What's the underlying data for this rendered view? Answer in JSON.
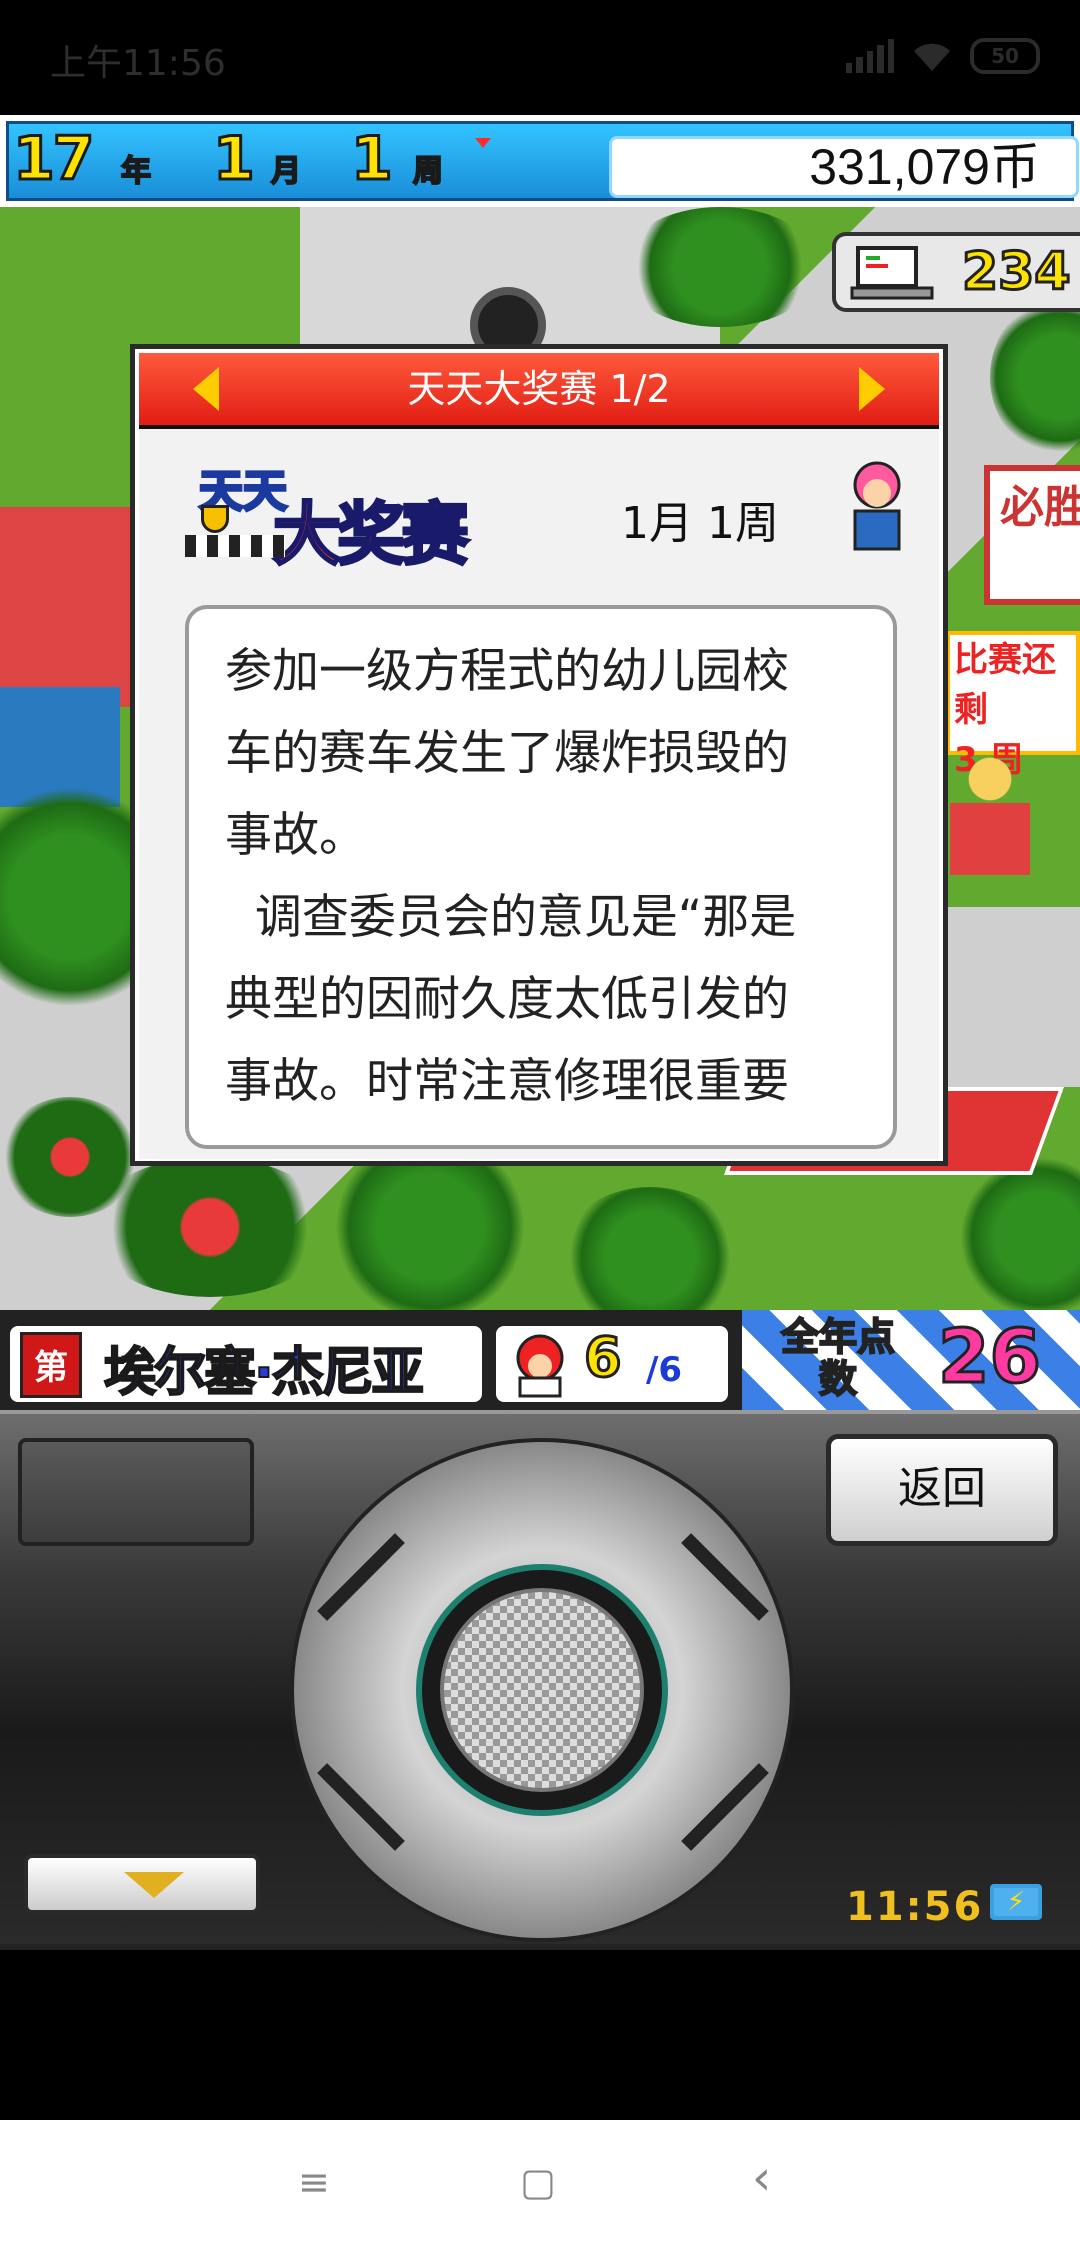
{
  "status_bar": {
    "time": "上午11:56",
    "battery": "50"
  },
  "topbar": {
    "year": "17",
    "year_unit": "年",
    "month": "1",
    "month_unit": "月",
    "week": "1",
    "week_unit": "周",
    "money": "331,079币"
  },
  "counter": {
    "value": "234"
  },
  "map_signs": {
    "sign1": "必胜",
    "sign2": "比赛还剩",
    "sign3": "3 周"
  },
  "dialog": {
    "title": "天天大奖赛 1/2",
    "logo_line1": "天天",
    "logo_line2": "大奖赛",
    "date": "1月 1周",
    "message": "参加一级方程式的幼儿园校\n车的赛车发生了爆炸损毁的\n事故。\n  调查委员会的意见是“那是\n典型的因耐久度太低引发的\n事故。时常注意修理很重要"
  },
  "info": {
    "rank_badge": "第1",
    "team_name": "埃尔塞·杰尼亚",
    "count": "6",
    "count_total": "/6",
    "points_label": "全年点数",
    "points_value": "26"
  },
  "controller": {
    "back_label": "返回",
    "clock": "11:56"
  },
  "navbar": {
    "menu_icon": "≡",
    "home_icon": "▢",
    "back_icon": "‹"
  },
  "colors": {
    "header_red": "#e11d14",
    "topbar_blue": "#1a8ed8",
    "accent_yellow": "#ffe300"
  }
}
